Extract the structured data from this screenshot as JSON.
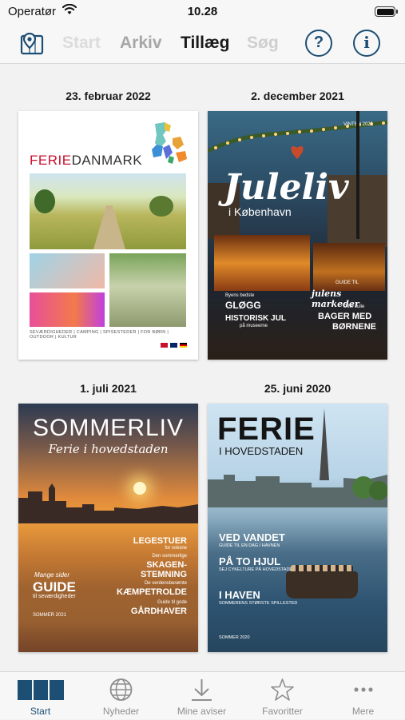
{
  "status_bar": {
    "carrier": "Operatør",
    "time": "10.28",
    "battery_level": 1.0
  },
  "nav": {
    "map_icon": "map-pin-icon",
    "tabs": [
      {
        "label": "Start",
        "state": "faded"
      },
      {
        "label": "Arkiv",
        "state": "inactive"
      },
      {
        "label": "Tillæg",
        "state": "active"
      },
      {
        "label": "Søg",
        "state": "faded"
      }
    ],
    "help_label": "?",
    "info_label": "i",
    "accent_color": "#1d4e73"
  },
  "issues": [
    {
      "date": "23. februar 2022",
      "cover": {
        "brand_red": "FERIE",
        "brand_rest": "DANMARK",
        "tagline": "SEVÆRDIGHEDER | CAMPING | SPISESTEDER | FOR BØRN | OUTDOOR | KULTUR"
      }
    },
    {
      "date": "2. december 2021",
      "cover": {
        "season": "VINTER 2021",
        "title": "Juleliv",
        "subtitle": "i København",
        "guide_line1": "GUIDE TIL",
        "guide_line2": "julens markeder",
        "glogg_small": "Byens bedste",
        "glogg": "GLØGG",
        "historisk": "HISTORISK JUL",
        "historisk_small": "på museerne",
        "ditte_small": "Ditte Julie",
        "bager1": "BAGER MED",
        "bager2": "BØRNENE"
      }
    },
    {
      "date": "1. juli 2021",
      "cover": {
        "title": "SOMMERLIV",
        "subtitle": "Ferie i hovedstaden",
        "leg": "LEGESTUER",
        "leg_small": "for voksne",
        "skagen_small": "Den sommerlige",
        "skagen1": "SKAGEN-",
        "skagen2": "STEMNING",
        "trolde_small": "De verdensberømte",
        "trolde": "KÆMPETROLDE",
        "gard_small": "Guide til gode",
        "gard": "GÅRDHAVER",
        "guide_small": "Mange sider",
        "guide": "GUIDE",
        "guide_sub": "til seværdigheder",
        "season": "SOMMER 2021"
      }
    },
    {
      "date": "25. juni 2020",
      "cover": {
        "title": "FERIE",
        "subtitle": "I HOVEDSTADEN",
        "ved": "VED VANDET",
        "ved_small": "GUIDE TIL EN DAG I HAVNEN",
        "hjul": "PÅ TO HJUL",
        "hjul_small": "SEJ CYKELTURE PÅ HOVEDSTADENS RUTER",
        "haven": "I HAVEN",
        "haven_small": "SOMMERENS STØRSTE SPILLESTED",
        "season": "SOMMER 2020"
      }
    }
  ],
  "tabbar": {
    "items": [
      {
        "label": "Start",
        "icon": "newspapers-icon",
        "active": true
      },
      {
        "label": "Nyheder",
        "icon": "globe-icon",
        "active": false
      },
      {
        "label": "Mine aviser",
        "icon": "download-icon",
        "active": false
      },
      {
        "label": "Favoritter",
        "icon": "star-icon",
        "active": false
      },
      {
        "label": "Mere",
        "icon": "more-dots-icon",
        "active": false
      }
    ]
  }
}
